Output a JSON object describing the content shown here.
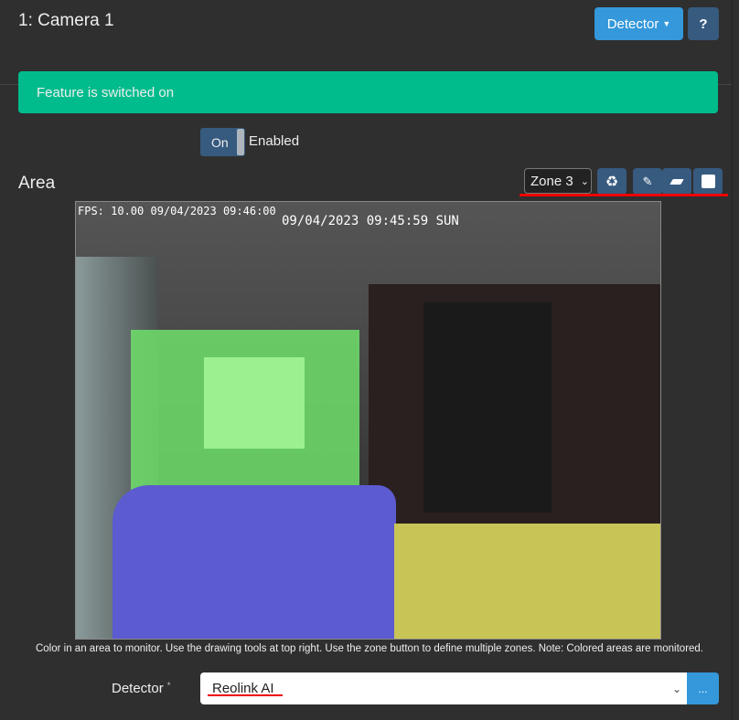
{
  "header": {
    "title": "1: Camera 1",
    "detector_button": "Detector",
    "help_button": "?"
  },
  "alert": {
    "text": "Feature is switched on"
  },
  "toggle": {
    "state_label": "On",
    "label": "Enabled"
  },
  "area": {
    "heading": "Area",
    "zone_select": "Zone 3",
    "tools": [
      {
        "name": "reset",
        "icon": "recycle-icon"
      },
      {
        "name": "pencil",
        "icon": "pencil-icon"
      },
      {
        "name": "eraser",
        "icon": "eraser-icon"
      },
      {
        "name": "fill",
        "icon": "square-icon"
      }
    ]
  },
  "camera": {
    "fps_overlay": "FPS: 10.00 09/04/2023 09:46:00",
    "timestamp": "09/04/2023 09:45:59 SUN",
    "zone_colors": {
      "green": "#6fe06a",
      "purple": "#5c5bd0",
      "yellow": "#c8c456"
    }
  },
  "help_text": "Color in an area to monitor. Use the drawing tools at top right. Use the zone button to define multiple zones. Note: Colored areas are monitored.",
  "detector": {
    "label": "Detector",
    "required_mark": "*",
    "value": "Reolink AI",
    "more_button": "..."
  },
  "colors": {
    "accent": "#3498db",
    "success": "#00bc8c",
    "secondary": "#375a7f",
    "highlight": "#e00000"
  }
}
